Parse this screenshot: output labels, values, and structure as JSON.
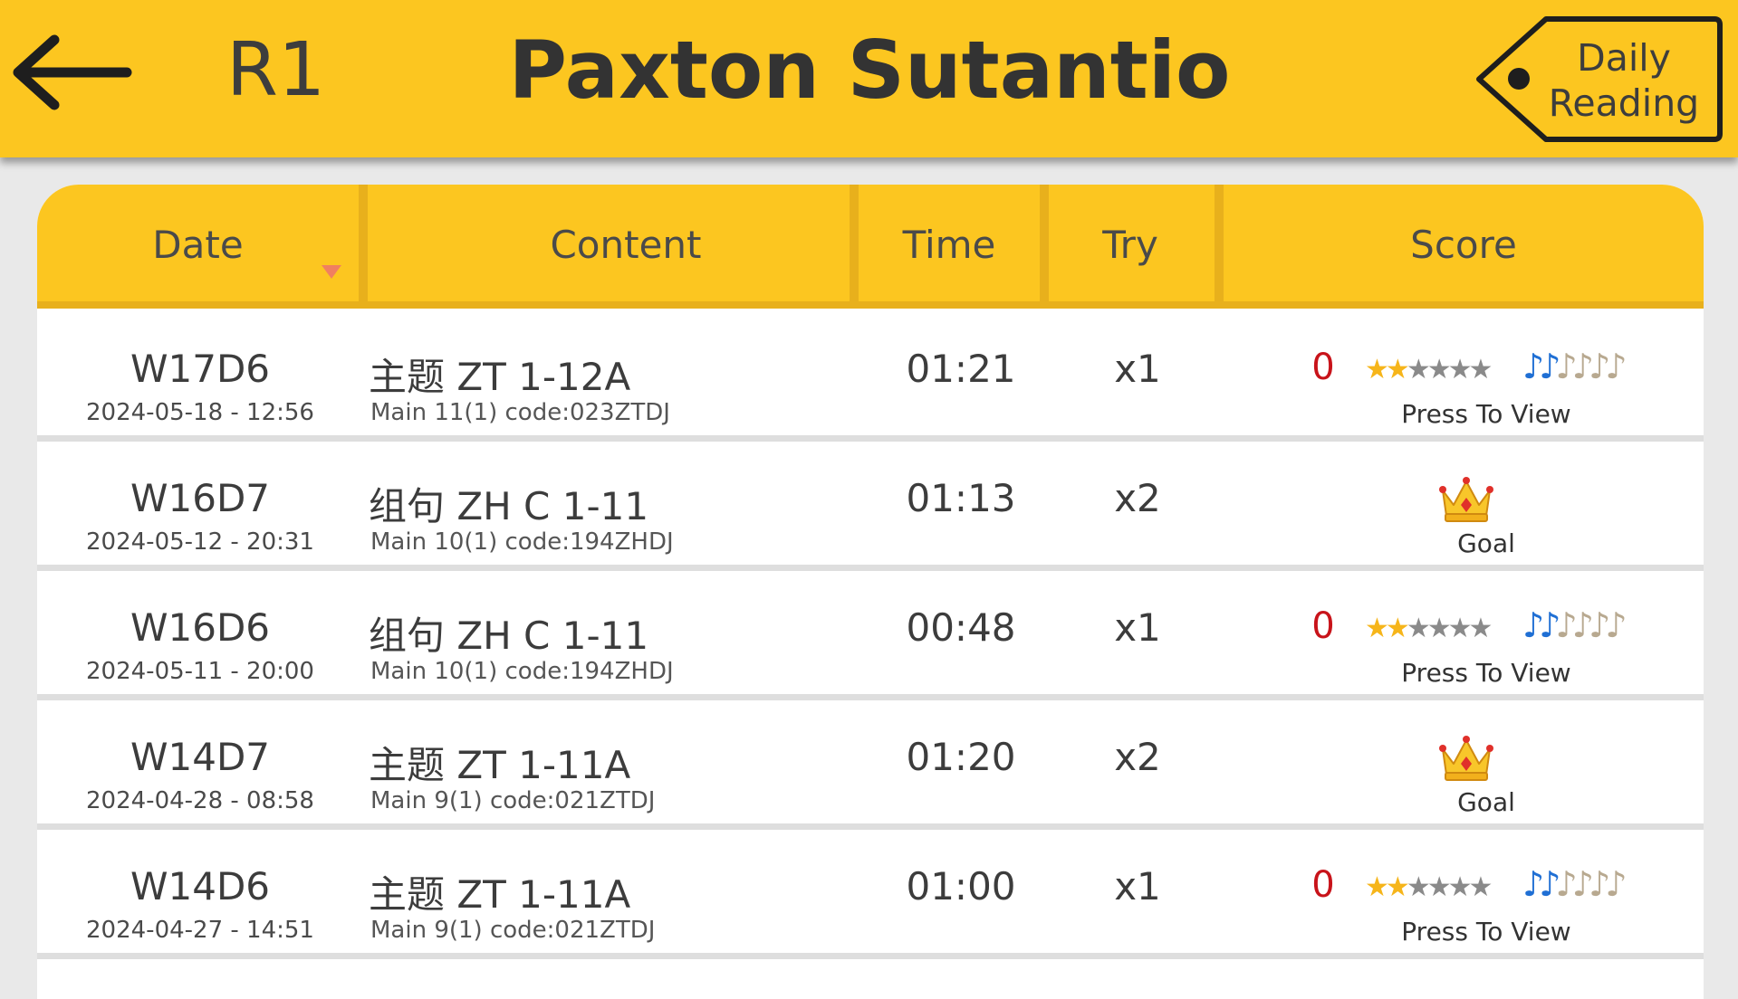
{
  "header": {
    "level": "R1",
    "student_name": "Paxton Sutantio",
    "daily_reading_line1": "Daily",
    "daily_reading_line2": "Reading"
  },
  "table": {
    "columns": [
      "Date",
      "Content",
      "Time",
      "Try",
      "Score"
    ],
    "sort_column": "Date",
    "rows": [
      {
        "week": "W17D6",
        "datetime": "2024-05-18 - 12:56",
        "content": "主题 ZT 1-12A",
        "content_sub": "Main 11(1) code:023ZTDJ",
        "time": "01:21",
        "try": "x1",
        "result": "score",
        "score": "0",
        "stars": 2,
        "stars_total": 6,
        "notes": 2,
        "notes_total": 6,
        "action": "Press To View"
      },
      {
        "week": "W16D7",
        "datetime": "2024-05-12 - 20:31",
        "content": "组句 ZH C 1-11",
        "content_sub": "Main 10(1) code:194ZHDJ",
        "time": "01:13",
        "try": "x2",
        "result": "goal",
        "action": "Goal"
      },
      {
        "week": "W16D6",
        "datetime": "2024-05-11 - 20:00",
        "content": "组句 ZH C 1-11",
        "content_sub": "Main 10(1) code:194ZHDJ",
        "time": "00:48",
        "try": "x1",
        "result": "score",
        "score": "0",
        "stars": 2,
        "stars_total": 6,
        "notes": 2,
        "notes_total": 6,
        "action": "Press To View"
      },
      {
        "week": "W14D7",
        "datetime": "2024-04-28 - 08:58",
        "content": "主题 ZT 1-11A",
        "content_sub": "Main 9(1) code:021ZTDJ",
        "time": "01:20",
        "try": "x2",
        "result": "goal",
        "action": "Goal"
      },
      {
        "week": "W14D6",
        "datetime": "2024-04-27 - 14:51",
        "content": "主题 ZT 1-11A",
        "content_sub": "Main 9(1) code:021ZTDJ",
        "time": "01:00",
        "try": "x1",
        "result": "score",
        "score": "0",
        "stars": 2,
        "stars_total": 6,
        "notes": 2,
        "notes_total": 6,
        "action": "Press To View"
      }
    ]
  },
  "colors": {
    "header_bg": "#fcc620",
    "header_dark": "#e8b01c",
    "score_red": "#c8131a",
    "star_gold": "#f6b51a",
    "note_blue": "#1f6fd4",
    "sort_arrow": "#f08060"
  },
  "icons": {
    "back": "arrow-left-icon",
    "tag": "tag-icon",
    "sort": "sort-down-icon",
    "star": "star-icon",
    "note": "music-note-icon",
    "crown": "crown-icon"
  }
}
